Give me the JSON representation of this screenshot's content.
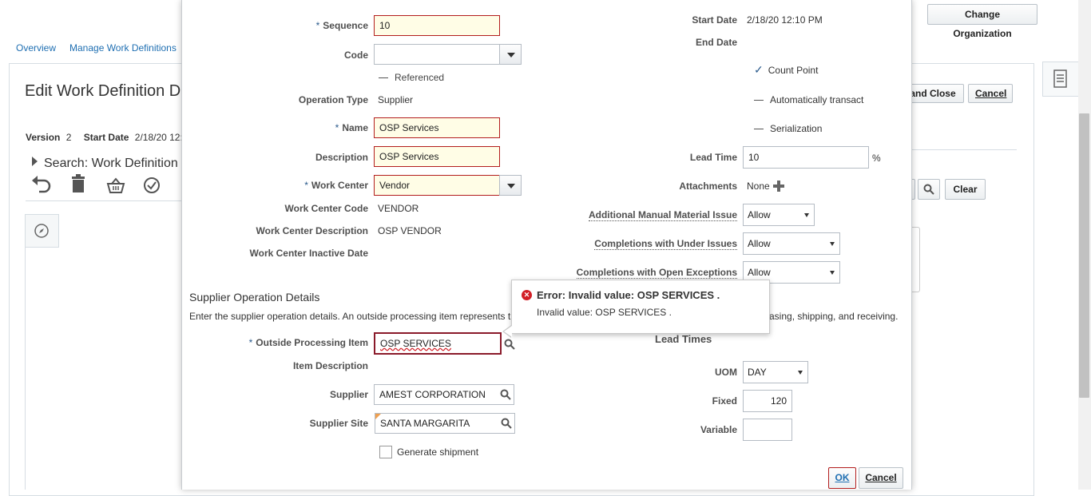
{
  "background": {
    "nav": {
      "overview": "Overview",
      "manage_work_definitions": "Manage Work Definitions"
    },
    "change_org_label": "Change Organization",
    "page_title": "Edit Work Definition D",
    "version_label": "Version",
    "version_value": "2",
    "start_date_label": "Start Date",
    "start_date_value": "2/18/20 12:",
    "search_label": "Search: Work Definition",
    "save_close_label": "and Close",
    "cancel_label": "Cancel",
    "clear_label": "Clear",
    "link_fragment": "l"
  },
  "dialog": {
    "left": {
      "sequence": {
        "label": "Sequence",
        "value": "10"
      },
      "code": {
        "label": "Code",
        "value": ""
      },
      "referenced": "Referenced",
      "operation_type": {
        "label": "Operation Type",
        "value": "Supplier"
      },
      "name": {
        "label": "Name",
        "value": "OSP Services"
      },
      "description": {
        "label": "Description",
        "value": "OSP Services"
      },
      "work_center": {
        "label": "Work Center",
        "value": "Vendor"
      },
      "work_center_code": {
        "label": "Work Center Code",
        "value": "VENDOR"
      },
      "work_center_description": {
        "label": "Work Center Description",
        "value": "OSP VENDOR"
      },
      "work_center_inactive_date": {
        "label": "Work Center Inactive Date",
        "value": ""
      }
    },
    "right": {
      "start_date": {
        "label": "Start Date",
        "value": "2/18/20 12:10 PM"
      },
      "end_date": {
        "label": "End Date",
        "value": ""
      },
      "count_point": "Count Point",
      "auto_transact": "Automatically transact",
      "serialization": "Serialization",
      "lead_time": {
        "label": "Lead Time",
        "value": "10",
        "unit": "%"
      },
      "attachments": {
        "label": "Attachments",
        "value": "None"
      },
      "additional_manual_material_issue": {
        "label": "Additional Manual Material Issue",
        "value": "Allow"
      },
      "completions_under_issues": {
        "label": "Completions with Under Issues",
        "value": "Allow"
      },
      "completions_open_exceptions": {
        "label": "Completions with Open Exceptions",
        "value": "Allow"
      }
    },
    "supplier": {
      "section_title": "Supplier Operation Details",
      "description_part1": "Enter the supplier operation details. An outside processing item represents th",
      "description_part2": "asing, shipping, and receiving.",
      "outside_processing_item": {
        "label": "Outside Processing Item",
        "value": "OSP SERVICES"
      },
      "item_description": {
        "label": "Item Description",
        "value": ""
      },
      "supplier": {
        "label": "Supplier",
        "value": "AMEST CORPORATION"
      },
      "supplier_site": {
        "label": "Supplier Site",
        "value": "SANTA MARGARITA"
      },
      "generate_shipment": "Generate shipment"
    },
    "lead_times": {
      "title": "Lead Times",
      "uom": {
        "label": "UOM",
        "value": "DAY"
      },
      "fixed": {
        "label": "Fixed",
        "value": "120"
      },
      "variable": {
        "label": "Variable",
        "value": ""
      }
    },
    "error": {
      "title": "Error: Invalid value: OSP SERVICES .",
      "message": "Invalid value: OSP SERVICES ."
    },
    "buttons": {
      "ok": "OK",
      "cancel": "Cancel"
    }
  },
  "colors": {
    "error_red": "#d21f26",
    "link_blue": "#1f6fb2",
    "required_star": "#2a5a8c"
  }
}
